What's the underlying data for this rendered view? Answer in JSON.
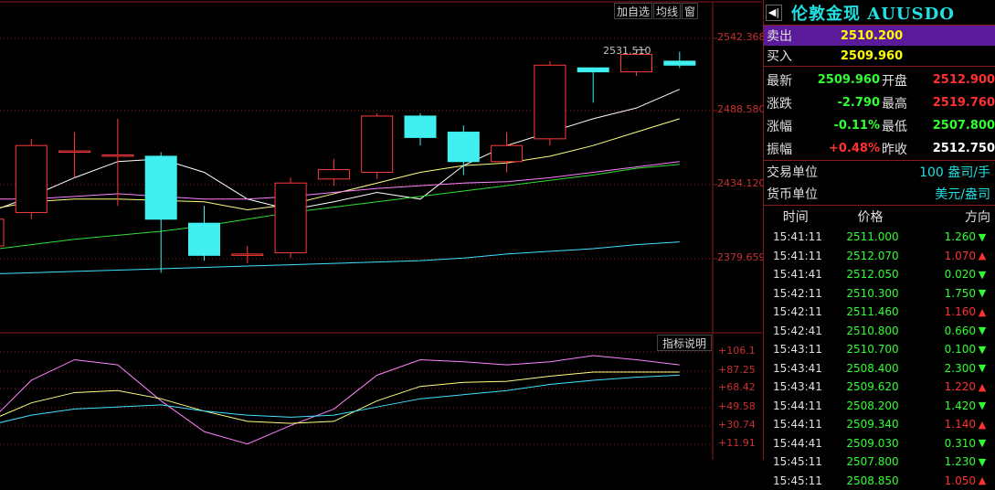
{
  "toolbar": {
    "add_watch": "加自选",
    "ma_line": "均线",
    "window": "窗"
  },
  "indicator_button": "指标说明",
  "colors": {
    "up": "#ff3030",
    "down": "#30ff30",
    "accent": "#20e0e0",
    "grid": "#8a1a1a",
    "highlight": "#5a1a9a"
  },
  "chart_data": [
    {
      "type": "candlestick",
      "ylim": [
        2340,
        2555
      ],
      "y_ticks": [
        "2542.368",
        "2488.580",
        "2434.120",
        "2379.659"
      ],
      "peak_label": "2531.510",
      "candles": [
        {
          "o": 2385,
          "c": 2405,
          "h": 2415,
          "l": 2378
        },
        {
          "o": 2410,
          "c": 2460,
          "h": 2465,
          "l": 2405
        },
        {
          "o": 2456,
          "c": 2456,
          "h": 2470,
          "l": 2436
        },
        {
          "o": 2453,
          "c": 2453,
          "h": 2480,
          "l": 2415
        },
        {
          "o": 2452,
          "c": 2405,
          "h": 2455,
          "l": 2365
        },
        {
          "o": 2402,
          "c": 2378,
          "h": 2415,
          "l": 2374
        },
        {
          "o": 2379,
          "c": 2379,
          "h": 2385,
          "l": 2372
        },
        {
          "o": 2380,
          "c": 2432,
          "h": 2436,
          "l": 2376
        },
        {
          "o": 2435,
          "c": 2442,
          "h": 2450,
          "l": 2430
        },
        {
          "o": 2440,
          "c": 2482,
          "h": 2484,
          "l": 2435
        },
        {
          "o": 2482,
          "c": 2466,
          "h": 2484,
          "l": 2460
        },
        {
          "o": 2470,
          "c": 2448,
          "h": 2475,
          "l": 2438
        },
        {
          "o": 2448,
          "c": 2460,
          "h": 2470,
          "l": 2440
        },
        {
          "o": 2465,
          "c": 2520,
          "h": 2523,
          "l": 2460
        },
        {
          "o": 2518,
          "c": 2515,
          "h": 2518,
          "l": 2492
        },
        {
          "o": 2515,
          "c": 2528,
          "h": 2531.51,
          "l": 2512
        },
        {
          "o": 2523,
          "c": 2520,
          "h": 2530,
          "l": 2518
        }
      ],
      "ma_series": [
        {
          "color": "#ffffff",
          "values": [
            2410,
            2422,
            2436,
            2448,
            2450,
            2440,
            2420,
            2412,
            2418,
            2425,
            2420,
            2445,
            2460,
            2470,
            2480,
            2488,
            2502
          ]
        },
        {
          "color": "#ffff80",
          "values": [
            2412,
            2418,
            2420,
            2420,
            2419,
            2418,
            2412,
            2416,
            2424,
            2432,
            2440,
            2445,
            2447,
            2452,
            2460,
            2470,
            2480
          ]
        },
        {
          "color": "#ff80ff",
          "values": [
            2420,
            2420,
            2422,
            2424,
            2422,
            2420,
            2420,
            2422,
            2425,
            2428,
            2430,
            2432,
            2433,
            2436,
            2440,
            2444,
            2448
          ]
        },
        {
          "color": "#30e030",
          "values": [
            2382,
            2386,
            2390,
            2393,
            2396,
            2400,
            2405,
            2410,
            2414,
            2418,
            2422,
            2426,
            2430,
            2434,
            2438,
            2443,
            2446
          ]
        },
        {
          "color": "#40e0ff",
          "values": [
            2364,
            2365,
            2366,
            2367,
            2368,
            2369,
            2370,
            2371,
            2372,
            2373,
            2374,
            2376,
            2379,
            2381,
            2383,
            2386,
            2388
          ]
        }
      ]
    },
    {
      "type": "line",
      "ylim": [
        7,
        112
      ],
      "y_ticks": [
        "+106.1",
        "+87.25",
        "+68.42",
        "+49.58",
        "+30.74",
        "+11.91"
      ],
      "series": [
        {
          "color": "#ff80ff",
          "values": [
            38,
            80,
            100,
            95,
            60,
            30,
            18,
            36,
            52,
            85,
            100,
            98,
            95,
            98,
            104,
            100,
            95
          ]
        },
        {
          "color": "#ffff80",
          "values": [
            40,
            58,
            68,
            70,
            62,
            50,
            40,
            38,
            40,
            60,
            74,
            78,
            79,
            84,
            88,
            88,
            88
          ]
        },
        {
          "color": "#40e0ff",
          "values": [
            36,
            46,
            52,
            54,
            56,
            50,
            46,
            44,
            46,
            54,
            62,
            66,
            70,
            76,
            80,
            83,
            85
          ]
        }
      ]
    }
  ],
  "panel": {
    "title": "伦敦金现 AUUSDO",
    "title_btn": "◀|",
    "sell_label": "卖出",
    "sell_value": "2510.200",
    "buy_label": "买入",
    "buy_value": "2509.960",
    "stats": [
      {
        "l1": "最新",
        "v1": "2509.960",
        "c1": "green",
        "l2": "开盘",
        "v2": "2512.900",
        "c2": "red"
      },
      {
        "l1": "涨跌",
        "v1": "-2.790",
        "c1": "green",
        "l2": "最高",
        "v2": "2519.760",
        "c2": "red"
      },
      {
        "l1": "涨幅",
        "v1": "-0.11%",
        "c1": "green",
        "l2": "最低",
        "v2": "2507.800",
        "c2": "green"
      },
      {
        "l1": "振幅",
        "v1": "+0.48%",
        "c1": "red",
        "l2": "昨收",
        "v2": "2512.750",
        "c2": "white"
      }
    ],
    "trade_unit_label": "交易单位",
    "trade_unit_value": "100 盎司/手",
    "currency_label": "货币单位",
    "currency_value": "美元/盎司",
    "tick_headers": [
      "时间",
      "价格",
      "方向"
    ],
    "ticks": [
      {
        "t": "15:41:11",
        "p": "2511.000",
        "v": "1.260",
        "d": "down"
      },
      {
        "t": "15:41:11",
        "p": "2512.070",
        "v": "1.070",
        "d": "up"
      },
      {
        "t": "15:41:41",
        "p": "2512.050",
        "v": "0.020",
        "d": "down"
      },
      {
        "t": "15:42:11",
        "p": "2510.300",
        "v": "1.750",
        "d": "down"
      },
      {
        "t": "15:42:11",
        "p": "2511.460",
        "v": "1.160",
        "d": "up"
      },
      {
        "t": "15:42:41",
        "p": "2510.800",
        "v": "0.660",
        "d": "down"
      },
      {
        "t": "15:43:11",
        "p": "2510.700",
        "v": "0.100",
        "d": "down"
      },
      {
        "t": "15:43:41",
        "p": "2508.400",
        "v": "2.300",
        "d": "down"
      },
      {
        "t": "15:43:41",
        "p": "2509.620",
        "v": "1.220",
        "d": "up"
      },
      {
        "t": "15:44:11",
        "p": "2508.200",
        "v": "1.420",
        "d": "down"
      },
      {
        "t": "15:44:11",
        "p": "2509.340",
        "v": "1.140",
        "d": "up"
      },
      {
        "t": "15:44:41",
        "p": "2509.030",
        "v": "0.310",
        "d": "down"
      },
      {
        "t": "15:45:11",
        "p": "2507.800",
        "v": "1.230",
        "d": "down"
      },
      {
        "t": "15:45:11",
        "p": "2508.850",
        "v": "1.050",
        "d": "up"
      }
    ]
  }
}
